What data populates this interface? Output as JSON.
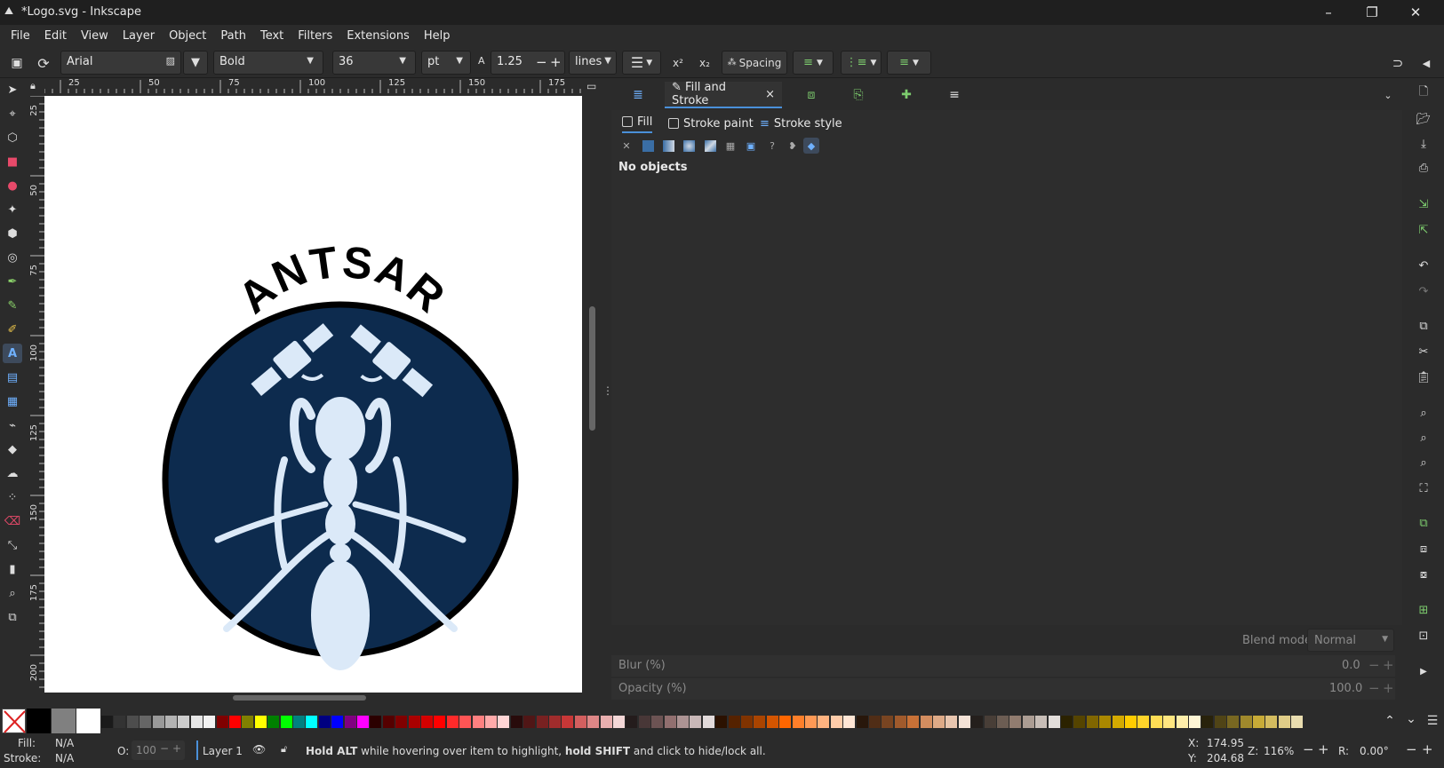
{
  "window": {
    "title": "*Logo.svg - Inkscape",
    "minimize": "–",
    "maximize": "❐",
    "close": "✕"
  },
  "menu": [
    "File",
    "Edit",
    "View",
    "Layer",
    "Object",
    "Path",
    "Text",
    "Filters",
    "Extensions",
    "Help"
  ],
  "text_toolbar": {
    "font_family": "Arial",
    "font_style": "Bold",
    "font_size": "36",
    "unit": "pt",
    "line_height_icon": "A",
    "line_height": "1.25",
    "minus": "−",
    "plus": "+",
    "line_unit": "lines",
    "spacing": "Spacing",
    "superscript": "x²",
    "subscript": "x₂"
  },
  "ruler": {
    "h_ticks": [
      "25",
      "50",
      "75",
      "100",
      "125",
      "150",
      "175"
    ],
    "v_ticks": [
      "25",
      "50",
      "75",
      "100",
      "125",
      "150",
      "175",
      "200"
    ]
  },
  "logo": {
    "text": "ANTSAR",
    "circle_color": "#0d2b4e",
    "ant_color": "#dbe9f8"
  },
  "dock": {
    "active_tab": "Fill and Stroke",
    "tab_close": "×",
    "subtabs": [
      "Fill",
      "Stroke paint",
      "Stroke style"
    ],
    "no_objects": "No objects",
    "blend_label": "Blend mode:",
    "blend_value": "Normal",
    "blur_label": "Blur (%)",
    "blur_value": "0.0",
    "opacity_label": "Opacity (%)",
    "opacity_value": "100.0"
  },
  "palette": {
    "colors": [
      "#000000",
      "#808080",
      "#ffffff",
      "#1a1a1a",
      "#333333",
      "#4d4d4d",
      "#666666",
      "#999999",
      "#b3b3b3",
      "#cccccc",
      "#e6e6e6",
      "#f2f2f2",
      "#800000",
      "#ff0000",
      "#808000",
      "#ffff00",
      "#008000",
      "#00ff00",
      "#008080",
      "#00ffff",
      "#000080",
      "#0000ff",
      "#800080",
      "#ff00ff",
      "#2b0000",
      "#550000",
      "#800000",
      "#aa0000",
      "#d40000",
      "#ff0000",
      "#ff2a2a",
      "#ff5555",
      "#ff8080",
      "#ffaaaa",
      "#ffd5d5",
      "#280b0b",
      "#501616",
      "#782121",
      "#a02c2c",
      "#c83737",
      "#d35f5f",
      "#de8787",
      "#e9afaf",
      "#f4d7d7",
      "#241c1c",
      "#483737",
      "#6c5353",
      "#916f6f",
      "#ac9393",
      "#c8b7b7",
      "#e3dbdb",
      "#2b1100",
      "#552200",
      "#803300",
      "#aa4400",
      "#d45500",
      "#ff6600",
      "#ff7f2a",
      "#ff9955",
      "#ffb380",
      "#ffccaa",
      "#ffe6d5",
      "#28170b",
      "#502d16",
      "#784421",
      "#a05a2c",
      "#c87137",
      "#d38d5f",
      "#deaa87",
      "#e9c6af",
      "#f4e3d7",
      "#241f1c",
      "#483e37",
      "#6c5d53",
      "#917c6f",
      "#ac9d93",
      "#c8beb7",
      "#e3dedb",
      "#2b2200",
      "#554400",
      "#806600",
      "#aa8800",
      "#d4aa00",
      "#ffcc00",
      "#ffd42a",
      "#ffdd55",
      "#ffe680",
      "#ffeeaa",
      "#fff6d5",
      "#28220b",
      "#504416",
      "#786721",
      "#a0892c",
      "#c8ab37",
      "#d4bc5f",
      "#dfcc87",
      "#e9ddaf"
    ]
  },
  "status": {
    "fill_label": "Fill:",
    "fill_value": "N/A",
    "stroke_label": "Stroke:",
    "stroke_value": "N/A",
    "opacity_label": "O:",
    "opacity_value": "100",
    "layer": "Layer 1",
    "message_bold1": "Hold ALT",
    "message_mid": " while hovering over item to highlight, ",
    "message_bold2": "hold SHIFT",
    "message_end": " and click to hide/lock all.",
    "x_label": "X:",
    "x_value": "174.95",
    "y_label": "Y:",
    "y_value": "204.68",
    "zoom_label": "Z:",
    "zoom_value": "116%",
    "rotate_label": "R:",
    "rotate_value": "0.00°"
  }
}
